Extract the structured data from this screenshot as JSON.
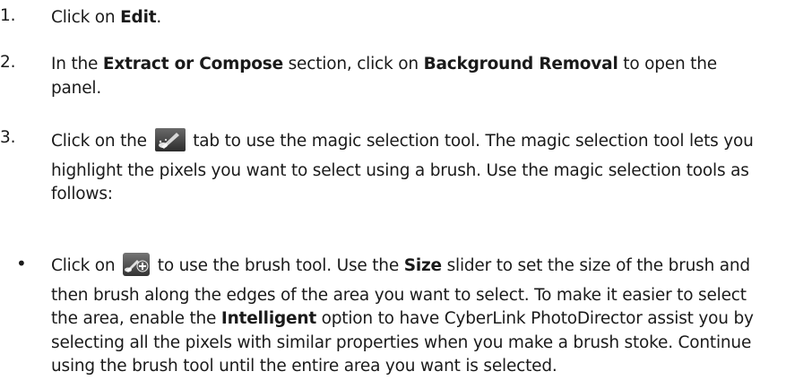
{
  "steps": [
    {
      "number": "1.",
      "pre": "Click on ",
      "bold": "Edit",
      "post": "."
    },
    {
      "number": "2.",
      "pre": "In the ",
      "bold1": "Extract or Compose",
      "mid": " section, click on ",
      "bold2": "Background Removal",
      "post": " to open the panel."
    },
    {
      "number": "3.",
      "pre": "Click on the ",
      "icon": "magic-wand-icon",
      "post": " tab to use the magic selection tool. The magic selection tool lets you highlight the pixels you want to select using a brush. Use the magic selection tools as follows:"
    }
  ],
  "bullet": {
    "dot": "•",
    "pre": "Click on ",
    "icon": "brush-add-icon",
    "mid1": " to use the brush tool. Use the ",
    "bold1": "Size",
    "mid2": " slider to set the size of the brush and then brush along the edges of the area you want to select. To make it easier to select the area, enable the ",
    "bold2": "Intelligent",
    "post": " option to have CyberLink PhotoDirector assist you by selecting all the pixels with similar properties when you make a brush stoke. Continue using the brush tool until the entire area you want is selected."
  }
}
